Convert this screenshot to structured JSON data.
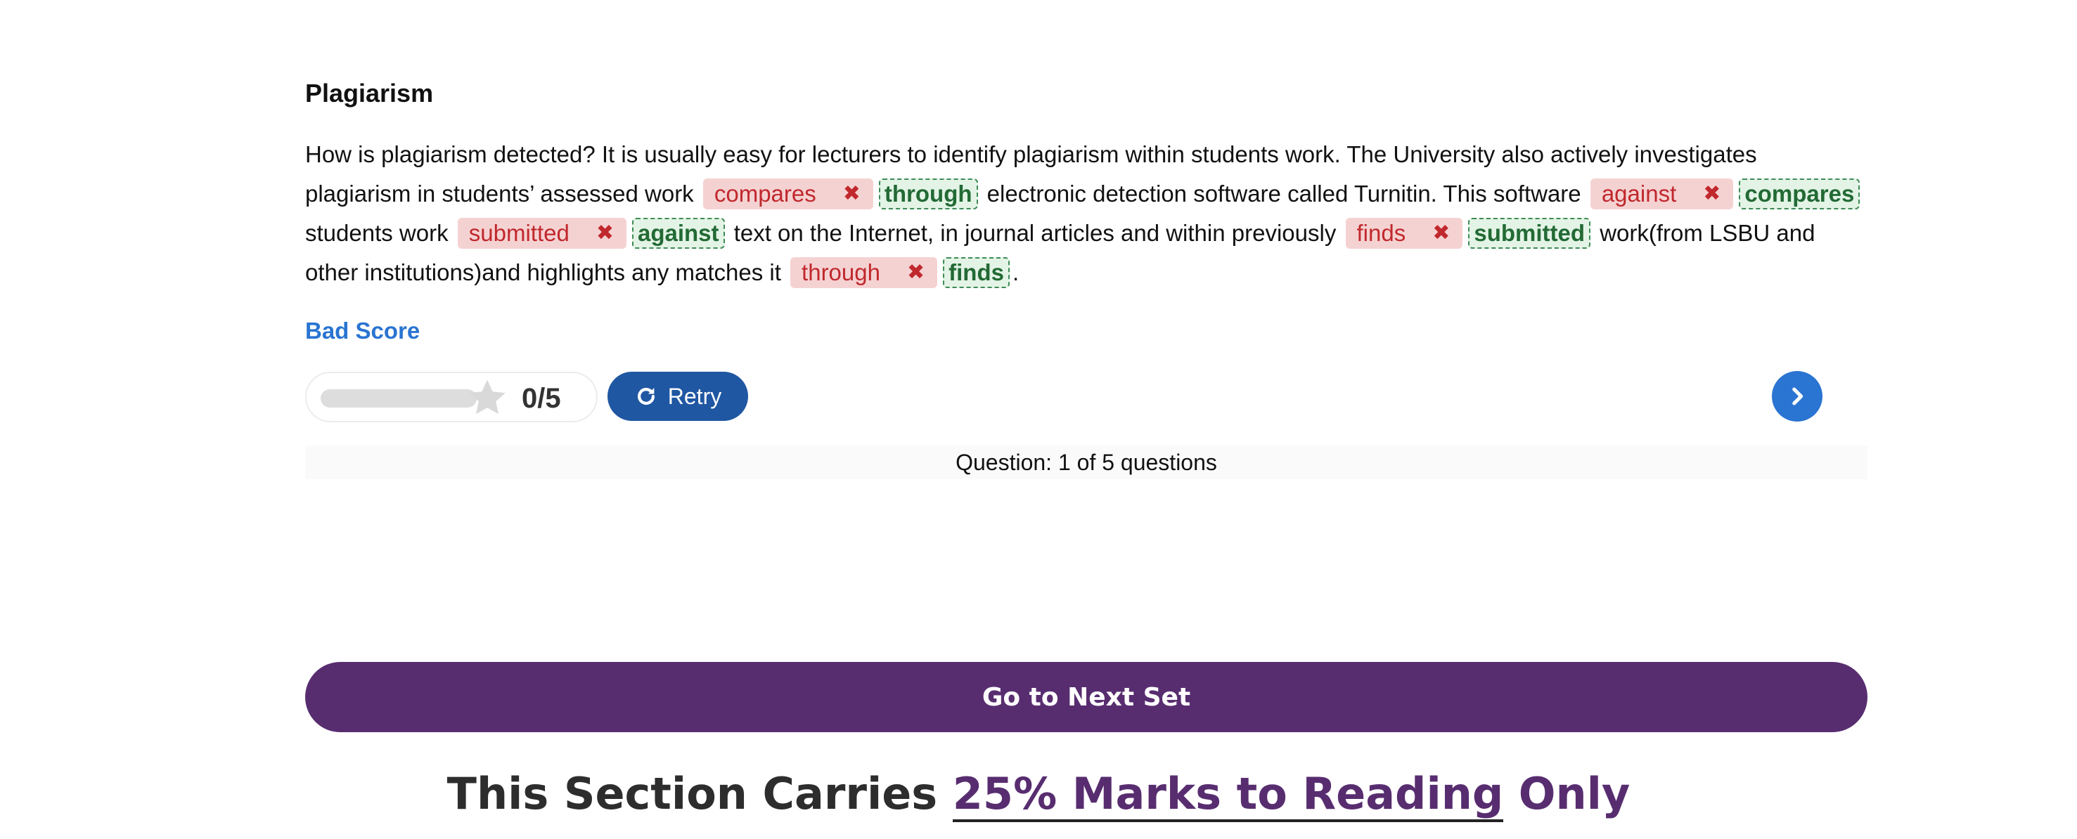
{
  "exercise": {
    "title": "Plagiarism",
    "passage": [
      {
        "type": "text",
        "value": "How is plagiarism detected? It is usually easy for lecturers to identify plagiarism within students work. The University also actively investigates plagiarism in students’ assessed work "
      },
      {
        "type": "gap",
        "answer": "compares",
        "correct": "through"
      },
      {
        "type": "text",
        "value": " electronic detection software called Turnitin. This software "
      },
      {
        "type": "gap",
        "answer": "against",
        "correct": "compares"
      },
      {
        "type": "text",
        "value": " students work "
      },
      {
        "type": "gap",
        "answer": "submitted",
        "correct": "against"
      },
      {
        "type": "text",
        "value": " text on the Internet, in journal articles and within previously "
      },
      {
        "type": "gap",
        "answer": "finds",
        "correct": "submitted"
      },
      {
        "type": "text",
        "value": " work(from LSBU and other institutions)and highlights any matches it "
      },
      {
        "type": "gap",
        "answer": "through",
        "correct": "finds"
      },
      {
        "type": "text",
        "value": "."
      }
    ],
    "wrong_mark_icon": "cross-icon"
  },
  "result": {
    "label": "Bad Score",
    "score_text": "0/5",
    "progress_fraction": 0,
    "star_icon": "star-icon"
  },
  "controls": {
    "retry_label": "Retry",
    "retry_icon": "rotate-right-icon",
    "next_icon": "chevron-right-icon"
  },
  "question_counter": "Question: 1 of 5 questions",
  "next_set_label": "Go to Next Set",
  "section_note": {
    "before": "This Section Carries ",
    "highlight": "25% Marks to Reading",
    "after": " Only"
  },
  "colors": {
    "wrong_bg": "#f5d2d2",
    "wrong_text": "#c0282d",
    "correct_bg": "#e3f4e6",
    "correct_text": "#236a35",
    "accent_blue": "#2a74d2",
    "retry_blue": "#1f57a3",
    "brand_purple": "#582d70"
  }
}
